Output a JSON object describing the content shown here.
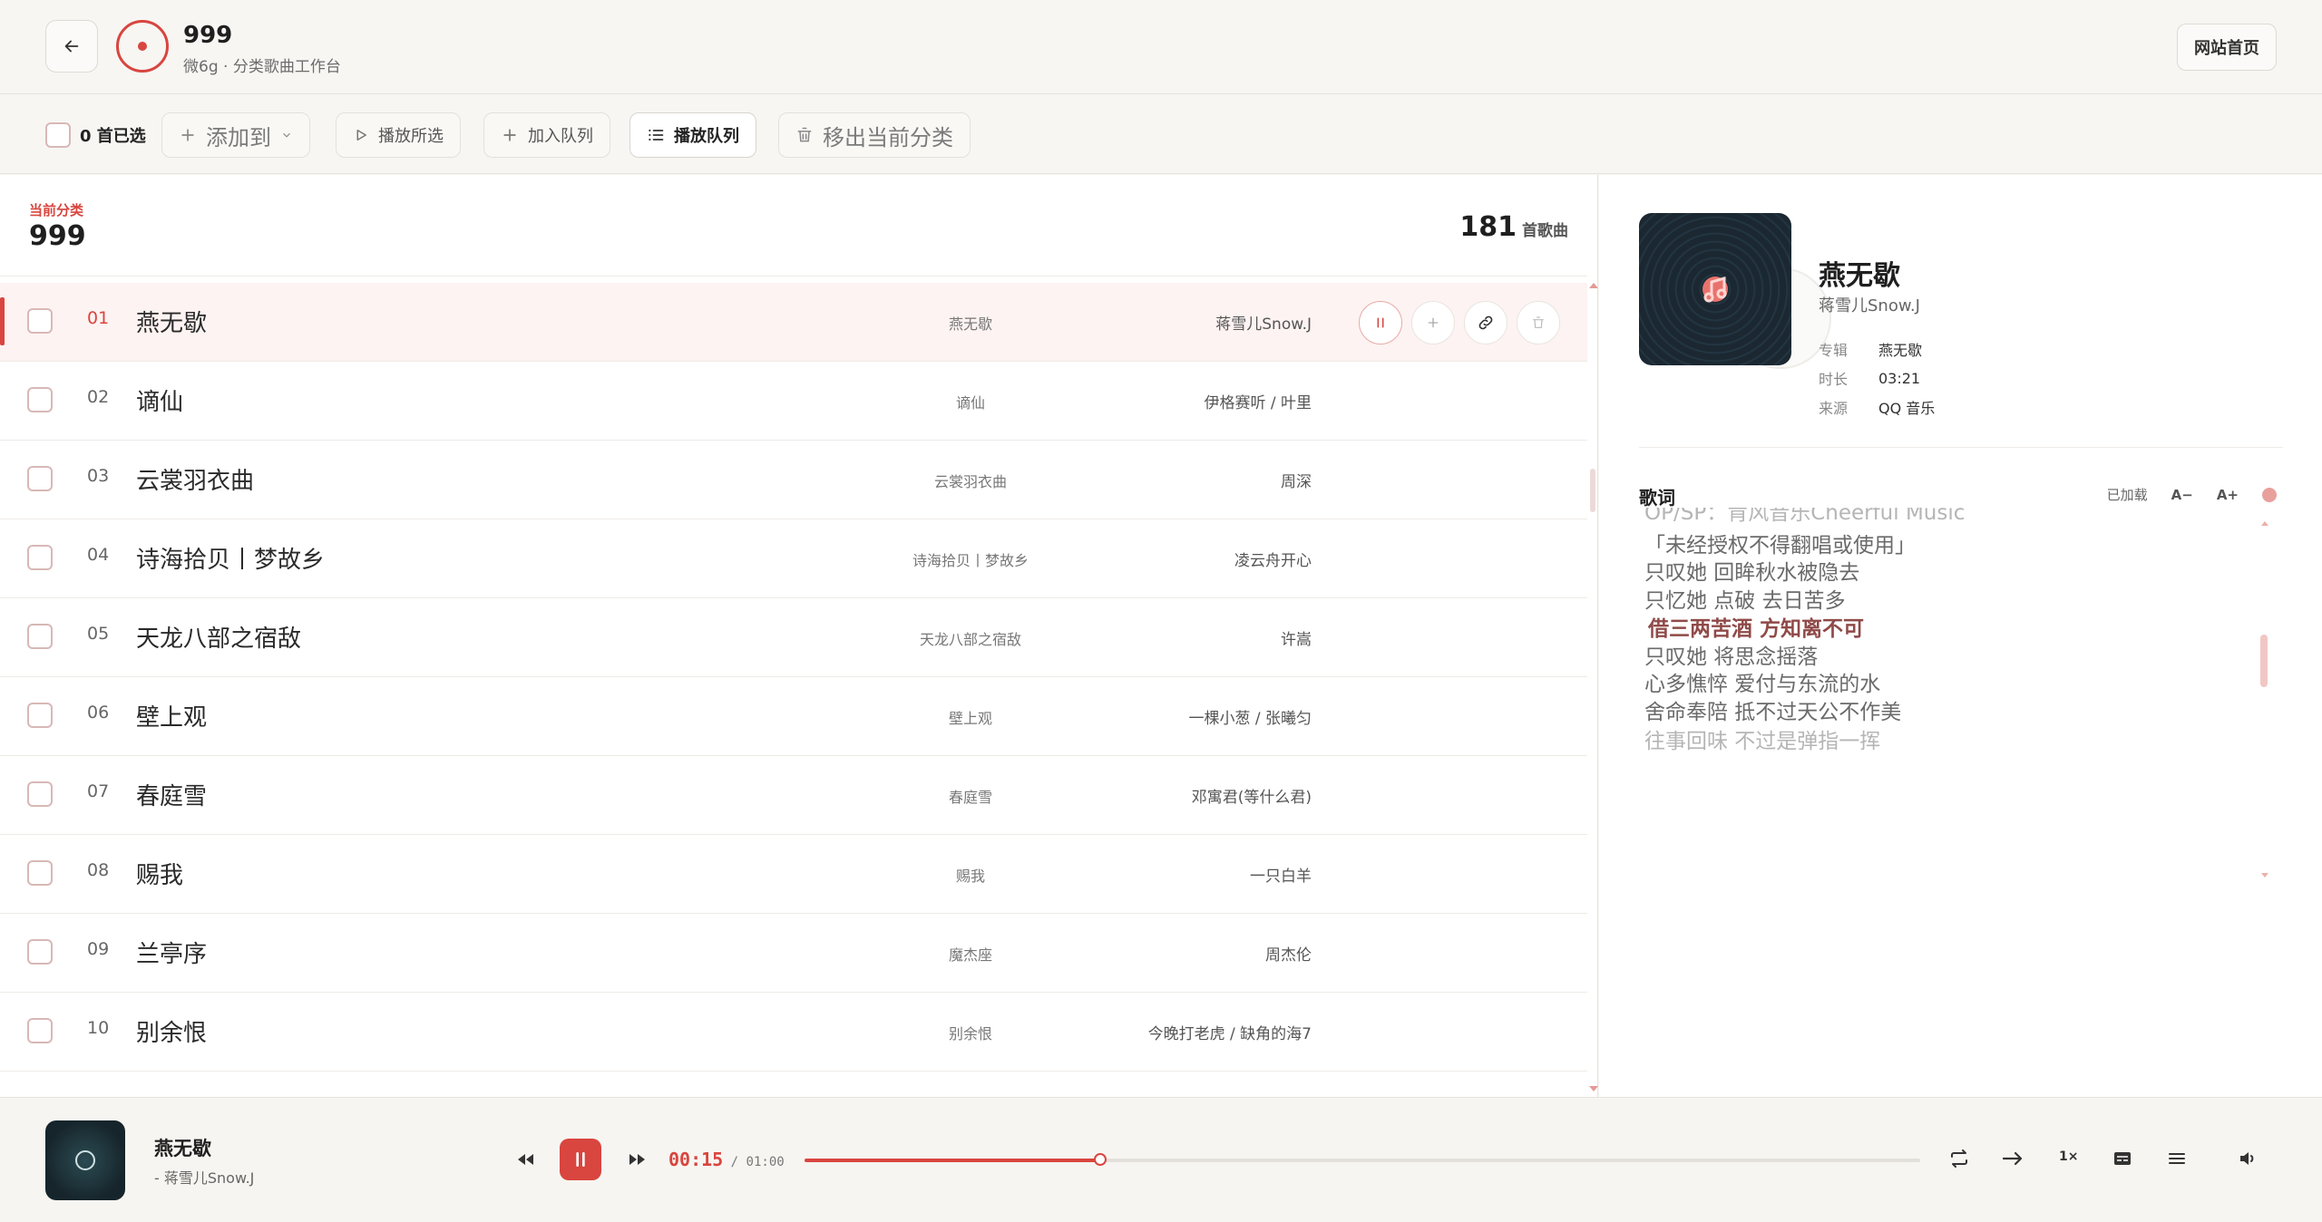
{
  "header": {
    "title": "999",
    "subtitle": "微6g · 分类歌曲工作台",
    "home_label": "网站首页"
  },
  "toolbar": {
    "selected_count": "0 首已选",
    "add_to": "添加到",
    "play_selected": "播放所选",
    "add_to_queue": "加入队列",
    "play_queue": "播放队列",
    "remove_from_category": "移出当前分类"
  },
  "category": {
    "label": "当前分类",
    "name": "999",
    "count": "181",
    "count_unit": "首歌曲"
  },
  "songs": [
    {
      "num": "01",
      "title": "燕无歇",
      "album": "燕无歇",
      "artist": "蒋雪儿Snow.J"
    },
    {
      "num": "02",
      "title": "谪仙",
      "album": "谪仙",
      "artist": "伊格赛听 / 叶里"
    },
    {
      "num": "03",
      "title": "云裳羽衣曲",
      "album": "云裳羽衣曲",
      "artist": "周深"
    },
    {
      "num": "04",
      "title": "诗海拾贝丨梦故乡",
      "album": "诗海拾贝丨梦故乡",
      "artist": "凌云舟开心"
    },
    {
      "num": "05",
      "title": "天龙八部之宿敌",
      "album": "天龙八部之宿敌",
      "artist": "许嵩"
    },
    {
      "num": "06",
      "title": "壁上观",
      "album": "壁上观",
      "artist": "一棵小葱 / 张曦匀"
    },
    {
      "num": "07",
      "title": "春庭雪",
      "album": "春庭雪",
      "artist": "邓寓君(等什么君)"
    },
    {
      "num": "08",
      "title": "赐我",
      "album": "赐我",
      "artist": "一只白羊"
    },
    {
      "num": "09",
      "title": "兰亭序",
      "album": "魔杰座",
      "artist": "周杰伦"
    },
    {
      "num": "10",
      "title": "别余恨",
      "album": "别余恨",
      "artist": "今晚打老虎 / 缺角的海7"
    }
  ],
  "now_playing": {
    "title": "燕无歇",
    "artist": "蒋雪儿Snow.J",
    "album_key": "专辑",
    "album": "燕无歇",
    "duration_key": "时长",
    "duration": "03:21",
    "source_key": "来源",
    "source": "QQ 音乐"
  },
  "lyrics": {
    "heading": "歌词",
    "status": "已加载",
    "smaller": "A−",
    "larger": "A+",
    "lines": [
      "OP/SP：肯风音乐Cheerful Music",
      "「未经授权不得翻唱或使用」",
      "只叹她 回眸秋水被隐去",
      "只忆她 点破 去日苦多",
      "借三两苦酒 方知离不可",
      "只叹她 将思念摇落",
      "心多憔悴 爱付与东流的水",
      "舍命奉陪 抵不过天公不作美",
      "往事回味 不过是弹指一挥"
    ],
    "active_index": 4
  },
  "player": {
    "title": "燕无歇",
    "artist": "- 蒋雪儿Snow.J",
    "current_time": "00:15",
    "separator": "/",
    "total_time": "01:00",
    "progress": 0.265,
    "speed": "1×"
  },
  "colors": {
    "accent": "#d9453f",
    "background": "#f7f6f3",
    "active_row": "#fdf3f2",
    "active_lyric": "#8f4a48"
  }
}
